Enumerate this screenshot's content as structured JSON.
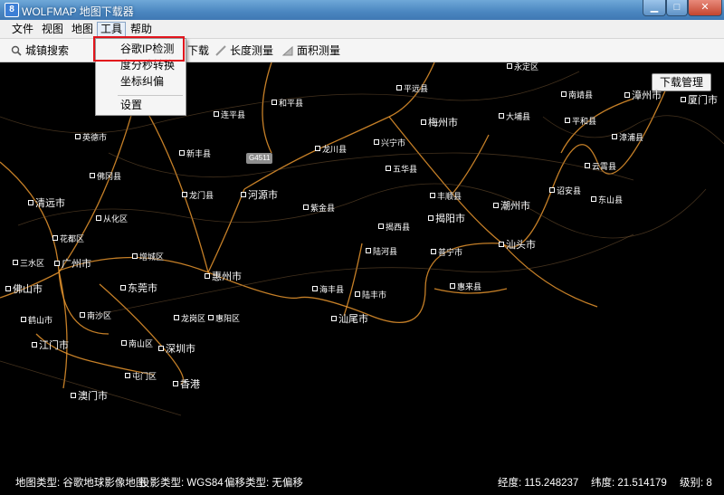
{
  "window": {
    "title": "WOLFMAP 地图下载器",
    "icon_text": "8"
  },
  "menu": [
    "文件",
    "视图",
    "地图",
    "工具",
    "帮助"
  ],
  "toolbar": {
    "city_search": "城镇搜索",
    "download_partial": "下载",
    "length_measure": "长度测量",
    "area_measure": "面积测量"
  },
  "dropdown": {
    "items": [
      "谷歌IP检测",
      "度分秒转换",
      "坐标纠偏",
      "设置"
    ]
  },
  "map": {
    "download_manager": "下载管理",
    "highway_shield": "G4511",
    "cities": [
      {
        "name": "永定区",
        "big": false
      },
      {
        "name": "平远县",
        "big": false
      },
      {
        "name": "南靖县",
        "big": false
      },
      {
        "name": "漳州市",
        "big": true
      },
      {
        "name": "厦门市",
        "big": true
      },
      {
        "name": "和平县",
        "big": false
      },
      {
        "name": "连平县",
        "big": false
      },
      {
        "name": "梅州市",
        "big": true
      },
      {
        "name": "大埔县",
        "big": false
      },
      {
        "name": "平和县",
        "big": false
      },
      {
        "name": "英德市",
        "big": false
      },
      {
        "name": "新丰县",
        "big": false
      },
      {
        "name": "龙川县",
        "big": false
      },
      {
        "name": "兴宁市",
        "big": false
      },
      {
        "name": "漳浦县",
        "big": false
      },
      {
        "name": "五华县",
        "big": false
      },
      {
        "name": "云霄县",
        "big": false
      },
      {
        "name": "佛冈县",
        "big": false
      },
      {
        "name": "龙门县",
        "big": false
      },
      {
        "name": "河源市",
        "big": true
      },
      {
        "name": "丰顺县",
        "big": false
      },
      {
        "name": "诏安县",
        "big": false
      },
      {
        "name": "东山县",
        "big": false
      },
      {
        "name": "清远市",
        "big": true
      },
      {
        "name": "紫金县",
        "big": false
      },
      {
        "name": "揭阳市",
        "big": true
      },
      {
        "name": "潮州市",
        "big": true
      },
      {
        "name": "从化区",
        "big": false
      },
      {
        "name": "揭西县",
        "big": false
      },
      {
        "name": "花都区",
        "big": false
      },
      {
        "name": "陆河县",
        "big": false
      },
      {
        "name": "普宁市",
        "big": false
      },
      {
        "name": "汕头市",
        "big": true
      },
      {
        "name": "三水区",
        "big": false
      },
      {
        "name": "广州市",
        "big": true
      },
      {
        "name": "增城区",
        "big": false
      },
      {
        "name": "惠州市",
        "big": true
      },
      {
        "name": "佛山市",
        "big": true
      },
      {
        "name": "东莞市",
        "big": true
      },
      {
        "name": "海丰县",
        "big": false
      },
      {
        "name": "陆丰市",
        "big": false
      },
      {
        "name": "惠来县",
        "big": false
      },
      {
        "name": "南沙区",
        "big": false
      },
      {
        "name": "鹤山市",
        "big": false
      },
      {
        "name": "龙岗区",
        "big": false
      },
      {
        "name": "惠阳区",
        "big": false
      },
      {
        "name": "汕尾市",
        "big": true
      },
      {
        "name": "江门市",
        "big": true
      },
      {
        "name": "南山区",
        "big": false
      },
      {
        "name": "深圳市",
        "big": true
      },
      {
        "name": "屯门区",
        "big": false
      },
      {
        "name": "香港",
        "big": true
      },
      {
        "name": "澳门市",
        "big": true
      }
    ]
  },
  "status": {
    "map_type": "地图类型: 谷歌地球影像地图",
    "projection": "投影类型: WGS84",
    "offset": "偏移类型: 无偏移",
    "lon": "经度:   115.248237",
    "lat": "纬度:   21.514179",
    "level": "级别: 8"
  },
  "colors": {
    "highlight": "#e2141c",
    "road": "#f0a03c"
  }
}
